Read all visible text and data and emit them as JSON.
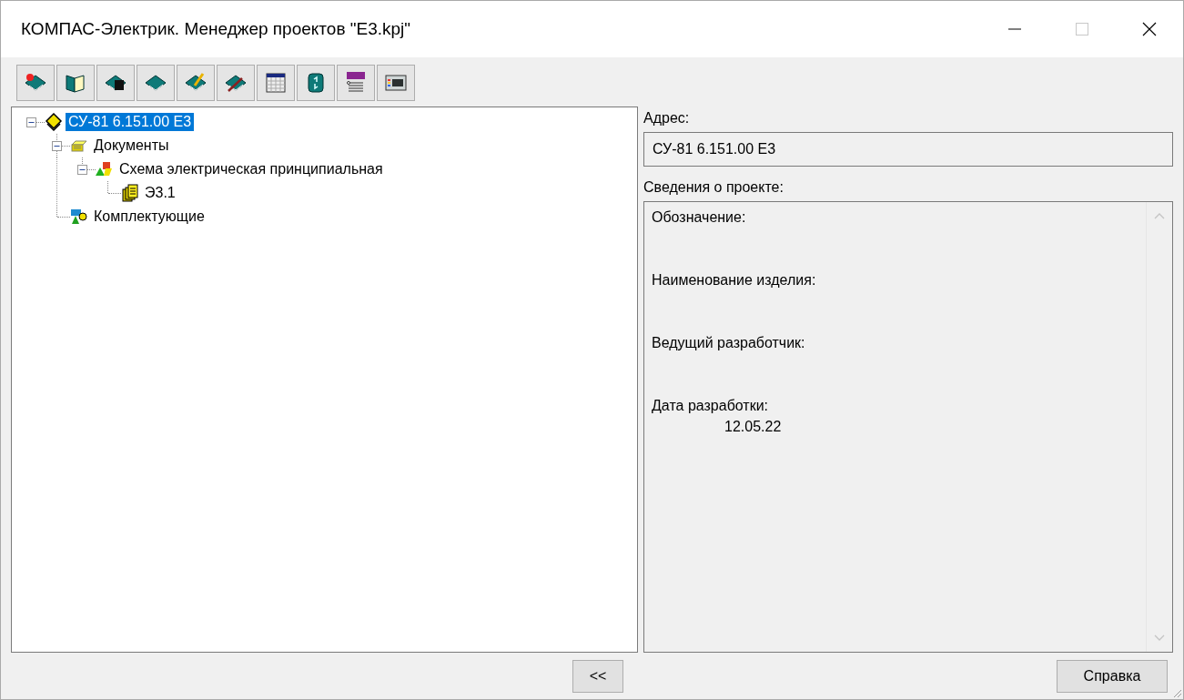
{
  "window": {
    "title": "КОМПАС-Электрик. Менеджер проектов \"E3.kpj\"",
    "maximize_disabled": true
  },
  "toolbar": [
    {
      "kind": "book-star"
    },
    {
      "kind": "book-open"
    },
    {
      "kind": "book-save"
    },
    {
      "kind": "book"
    },
    {
      "kind": "book-pen"
    },
    {
      "kind": "book-tool"
    },
    {
      "kind": "table"
    },
    {
      "kind": "cylinder"
    },
    {
      "kind": "exp"
    },
    {
      "kind": "panel"
    }
  ],
  "tree": [
    {
      "label": "СУ-81 6.151.00 Е3",
      "kind": "project",
      "selected": true,
      "expanded": true,
      "children": [
        {
          "label": "Документы",
          "kind": "docs",
          "selected": false,
          "expanded": true,
          "children": [
            {
              "label": "Схема электрическая принципиальная",
              "kind": "scheme",
              "selected": false,
              "expanded": true,
              "children": [
                {
                  "label": "Э3.1",
                  "kind": "sheet",
                  "selected": false
                }
              ]
            }
          ]
        },
        {
          "label": "Комплектующие",
          "kind": "parts",
          "selected": false
        }
      ]
    }
  ],
  "address": {
    "label": "Адрес:",
    "value": "СУ-81 6.151.00 Е3"
  },
  "info": {
    "label": "Сведения о проекте:",
    "items": [
      {
        "label": "Обозначение:"
      },
      {
        "label": "Наименование изделия:"
      },
      {
        "label": "Ведущий разработчик:"
      },
      {
        "label": "Дата разработки:",
        "value": "12.05.22"
      }
    ]
  },
  "buttons": {
    "collapse": "<<",
    "help": "Справка"
  }
}
